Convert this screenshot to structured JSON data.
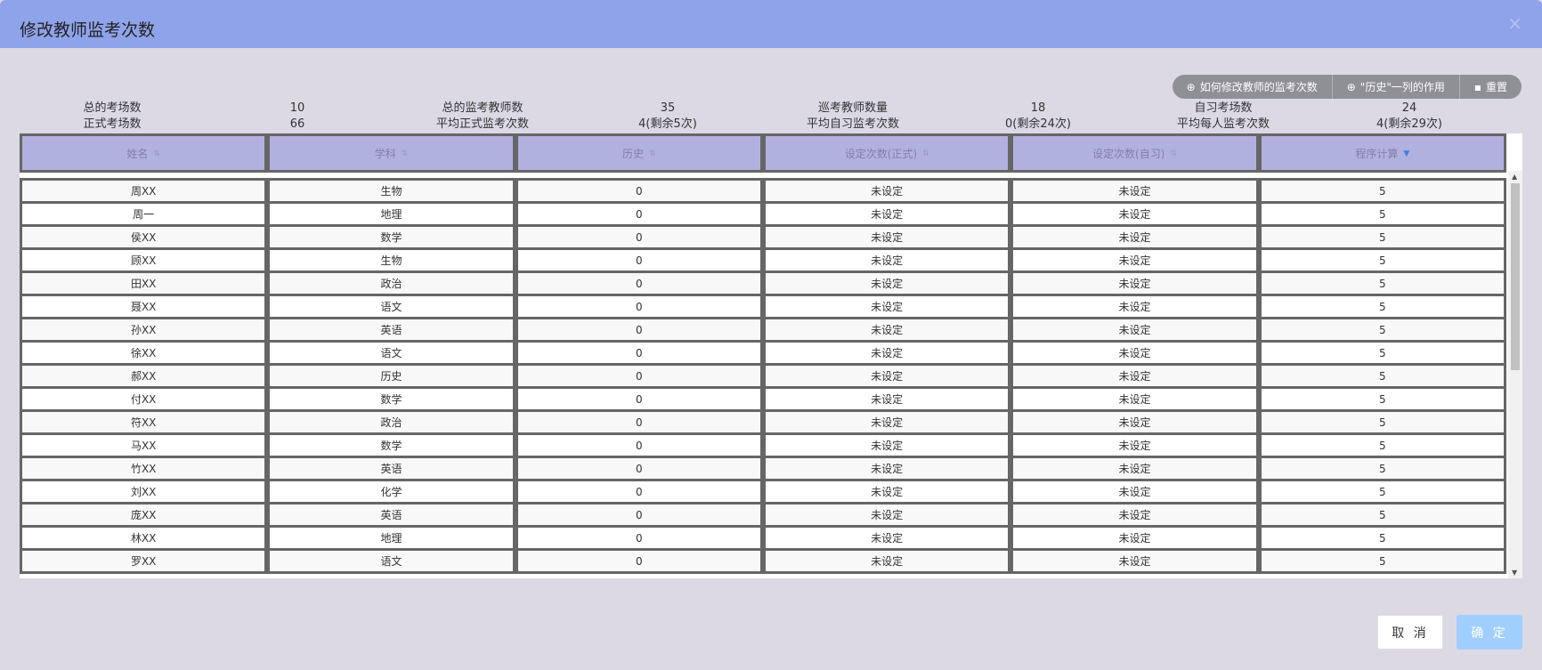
{
  "dialog": {
    "title": "修改教师监考次数",
    "close_icon": "×"
  },
  "toolbar": {
    "how_to_label": "如何修改教师的监考次数",
    "history_label": "\"历史\"一列的作用",
    "reset_label": "重置",
    "help_icon": "question-circle-icon",
    "reset_icon": "clipboard-icon"
  },
  "stats": {
    "row1": [
      {
        "label": "总的考场数",
        "value": "10"
      },
      {
        "label": "总的监考教师数",
        "value": "35"
      },
      {
        "label": "巡考教师数量",
        "value": "18"
      },
      {
        "label": "自习考场数",
        "value": "24"
      }
    ],
    "row2": [
      {
        "label": "正式考场数",
        "value": "66"
      },
      {
        "label": "平均正式监考次数",
        "value": "4(剩余5次)"
      },
      {
        "label": "平均自习监考次数",
        "value": "0(剩余24次)"
      },
      {
        "label": "平均每人监考次数",
        "value": "4(剩余29次)"
      }
    ]
  },
  "table": {
    "columns": [
      "姓名",
      "学科",
      "历史",
      "设定次数(正式)",
      "设定次数(自习)",
      "程序计算"
    ],
    "rows": [
      [
        "周XX",
        "生物",
        "0",
        "未设定",
        "未设定",
        "5"
      ],
      [
        "周一",
        "地理",
        "0",
        "未设定",
        "未设定",
        "5"
      ],
      [
        "侯XX",
        "数学",
        "0",
        "未设定",
        "未设定",
        "5"
      ],
      [
        "顾XX",
        "生物",
        "0",
        "未设定",
        "未设定",
        "5"
      ],
      [
        "田XX",
        "政治",
        "0",
        "未设定",
        "未设定",
        "5"
      ],
      [
        "聂XX",
        "语文",
        "0",
        "未设定",
        "未设定",
        "5"
      ],
      [
        "孙XX",
        "英语",
        "0",
        "未设定",
        "未设定",
        "5"
      ],
      [
        "徐XX",
        "语文",
        "0",
        "未设定",
        "未设定",
        "5"
      ],
      [
        "郝XX",
        "历史",
        "0",
        "未设定",
        "未设定",
        "5"
      ],
      [
        "付XX",
        "数学",
        "0",
        "未设定",
        "未设定",
        "5"
      ],
      [
        "符XX",
        "政治",
        "0",
        "未设定",
        "未设定",
        "5"
      ],
      [
        "马XX",
        "数学",
        "0",
        "未设定",
        "未设定",
        "5"
      ],
      [
        "竹XX",
        "英语",
        "0",
        "未设定",
        "未设定",
        "5"
      ],
      [
        "刘XX",
        "化学",
        "0",
        "未设定",
        "未设定",
        "5"
      ],
      [
        "庞XX",
        "英语",
        "0",
        "未设定",
        "未设定",
        "5"
      ],
      [
        "林XX",
        "地理",
        "0",
        "未设定",
        "未设定",
        "5"
      ],
      [
        "罗XX",
        "语文",
        "0",
        "未设定",
        "未设定",
        "5"
      ]
    ]
  },
  "footer": {
    "cancel_label": "取 消",
    "ok_label": "确 定"
  },
  "colors": {
    "header_bg": "#8fa3eb",
    "dialog_bg": "#dcd9e5",
    "table_header_bg": "#b1b1e0",
    "ok_button_bg": "#a0cfff",
    "sort_active": "#3e7fe0"
  }
}
